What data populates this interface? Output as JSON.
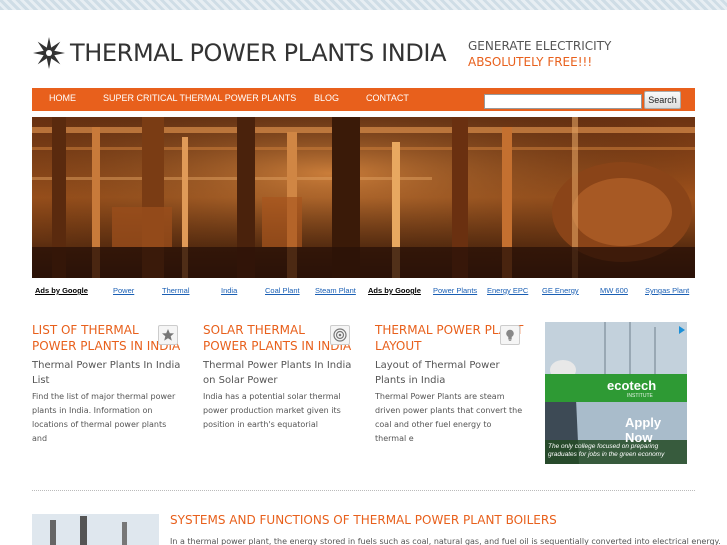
{
  "site": {
    "title": "THERMAL POWER PLANTS INDIA",
    "tagline_line1": "GENERATE ELECTRICITY",
    "tagline_line2": "ABSOLUTELY FREE!!!"
  },
  "nav": {
    "items": [
      {
        "label": "HOME"
      },
      {
        "label": "SUPER CRITICAL THERMAL POWER PLANTS"
      },
      {
        "label": "BLOG"
      },
      {
        "label": "CONTACT"
      }
    ],
    "search_value": "",
    "search_button": "Search"
  },
  "ads_bar": {
    "left_label": "Ads by Google",
    "left_links": [
      "Power",
      "Thermal",
      "India",
      "Coal Plant",
      "Steam Plant"
    ],
    "right_label": "Ads by Google",
    "right_links": [
      "Power Plants",
      "Energy EPC",
      "GE Energy",
      "MW 600",
      "Syngas Plant"
    ]
  },
  "features": [
    {
      "title": "LIST OF THERMAL POWER PLANTS IN INDIA",
      "subtitle": "Thermal Power Plants In India List",
      "description": "Find the list of major thermal power plants in India. Information on locations of thermal power plants and",
      "icon": "star-icon"
    },
    {
      "title": "SOLAR THERMAL POWER PLANTS IN INDIA",
      "subtitle": "Thermal Power Plants In India on Solar Power",
      "description": "India has a potential solar thermal power production market given its position in earth's equatorial",
      "icon": "target-icon"
    },
    {
      "title": "THERMAL POWER PLANT LAYOUT",
      "subtitle": "Layout of Thermal Power Plants in India",
      "description": "Thermal Power Plants are steam driven power plants that convert the coal and other fuel energy to thermal e",
      "icon": "lightbulb-icon"
    }
  ],
  "ad": {
    "brand": "ecotech",
    "brand_sub": "INSTITUTE",
    "cta": "Apply Now",
    "caption_line1": "The only college focused on preparing",
    "caption_line2": "graduates for jobs in the green economy"
  },
  "blog": {
    "title": "SYSTEMS AND FUNCTIONS OF THERMAL POWER PLANT BOILERS",
    "excerpt": "In a thermal power plant, the energy stored in fuels such as coal, natural gas, and fuel oil is sequentially converted into electrical energy."
  },
  "colors": {
    "accent": "#e8601c",
    "link": "#1a5fb4",
    "text": "#555555"
  }
}
